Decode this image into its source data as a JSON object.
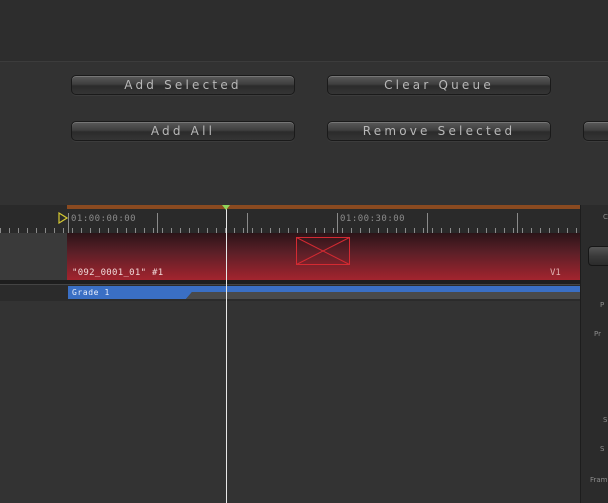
{
  "buttons": {
    "add_selected": "Add Selected",
    "clear_queue": "Clear Queue",
    "add_all": "Add All",
    "remove_selected": "Remove Selected"
  },
  "timeline": {
    "ruler_labels": [
      "01:00:00:00",
      "01:00:30:00"
    ],
    "clip_name": "\"092_0001_01\" #1",
    "clip_track": "V1",
    "grade_label": "Grade 1"
  },
  "right_panel": {
    "labels": [
      "C",
      "P",
      "Pr",
      "S",
      "S",
      "Fram"
    ]
  },
  "colors": {
    "background": "#2f2f2f",
    "clip_red": "#a3242e",
    "grade_blue": "#3a6fc4",
    "ruler_orange": "#8a4a20",
    "playhead_knob": "#8fd45a"
  }
}
